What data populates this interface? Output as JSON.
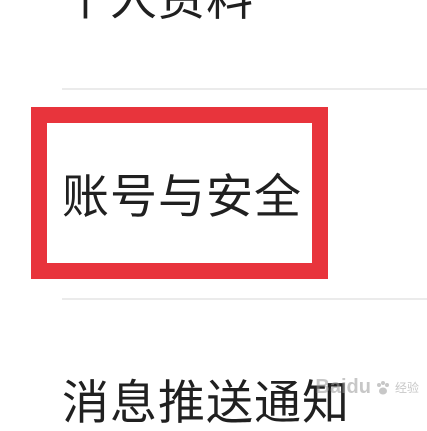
{
  "settings": {
    "items": [
      {
        "label": "个人资料"
      },
      {
        "label": "账号与安全"
      },
      {
        "label": "消息推送通知"
      }
    ]
  },
  "highlight": {
    "color": "#e8343c",
    "target": "账号与安全"
  },
  "watermark": {
    "logo": "Baidu",
    "sub": "经验",
    "icon": "paw-icon"
  }
}
